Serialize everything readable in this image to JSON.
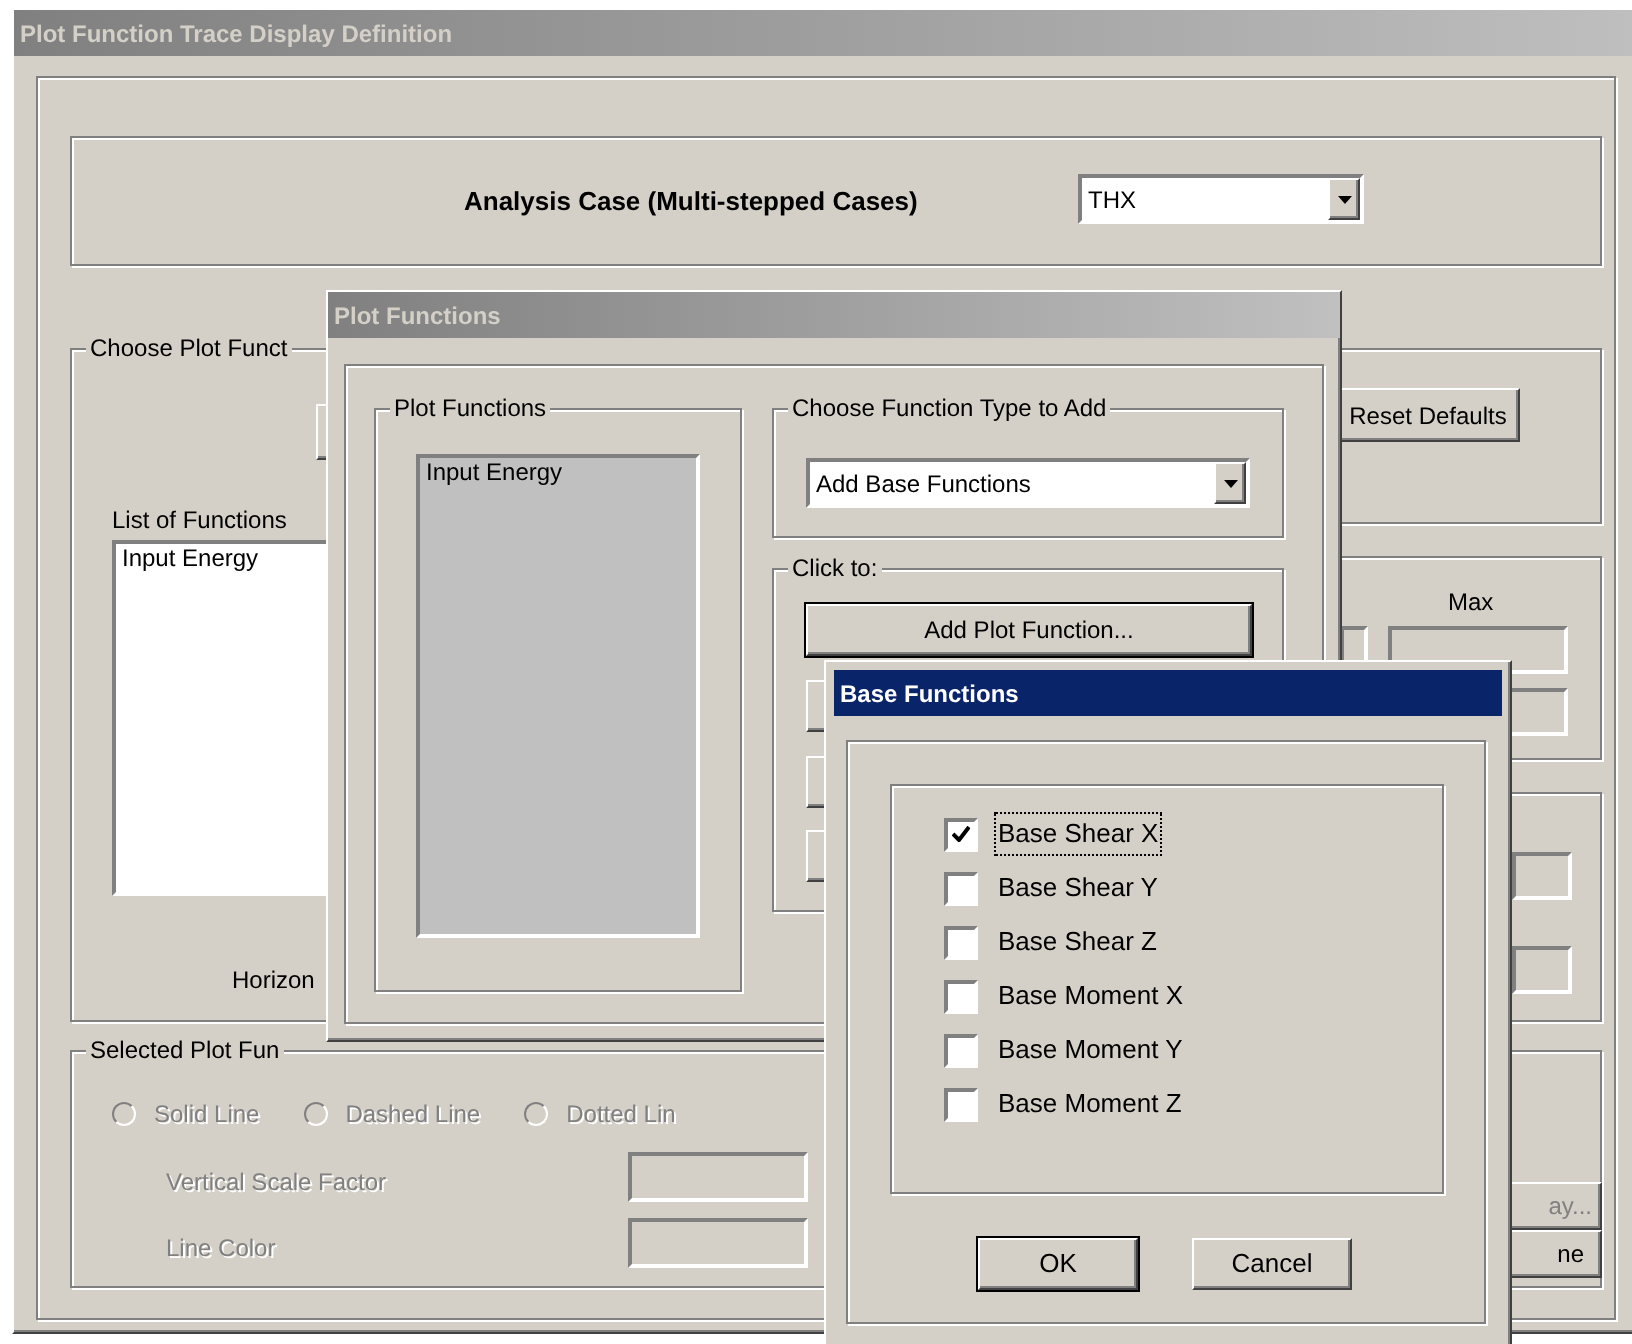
{
  "main_window": {
    "title": "Plot Function Trace Display Definition",
    "active": false,
    "analysis_case": {
      "label": "Analysis Case (Multi-stepped Cases)",
      "value": "THX"
    },
    "choose_group": {
      "legend": "Choose Plot Funct",
      "list_label": "List of Functions",
      "list_items": [
        "Input Energy"
      ],
      "horizontal_label": "Horizon"
    },
    "reset_button": "Reset Defaults",
    "range": {
      "max_label": "Max"
    },
    "line_options": {
      "legend": "Selected Plot Fun",
      "radios": [
        {
          "label": "Solid Line",
          "selected": false,
          "disabled": true
        },
        {
          "label": "Dashed Line",
          "selected": false,
          "disabled": true
        },
        {
          "label": "Dotted Lin",
          "selected": false,
          "disabled": true
        }
      ],
      "scale_label": "Vertical  Scale Factor",
      "color_label": "Line Color",
      "disabled": true
    },
    "partial_buttons": [
      "ay...",
      "ne"
    ]
  },
  "plot_functions_window": {
    "title": "Plot Functions",
    "active": false,
    "list_group": {
      "legend": "Plot Functions",
      "items": [
        "Input Energy"
      ]
    },
    "type_group": {
      "legend": "Choose  Function Type to Add",
      "value": "Add Base Functions"
    },
    "click_group": {
      "legend": "Click to:",
      "button": "Add Plot Function..."
    }
  },
  "base_functions_window": {
    "title": "Base Functions",
    "active": true,
    "items": [
      {
        "label": "Base Shear X",
        "checked": true,
        "focused": true
      },
      {
        "label": "Base Shear Y",
        "checked": false,
        "focused": false
      },
      {
        "label": "Base Shear Z",
        "checked": false,
        "focused": false
      },
      {
        "label": "Base Moment X",
        "checked": false,
        "focused": false
      },
      {
        "label": "Base Moment Y",
        "checked": false,
        "focused": false
      },
      {
        "label": "Base Moment Z",
        "checked": false,
        "focused": false
      }
    ],
    "buttons": [
      {
        "label": "OK",
        "default": true
      },
      {
        "label": "Cancel",
        "default": false
      }
    ]
  }
}
